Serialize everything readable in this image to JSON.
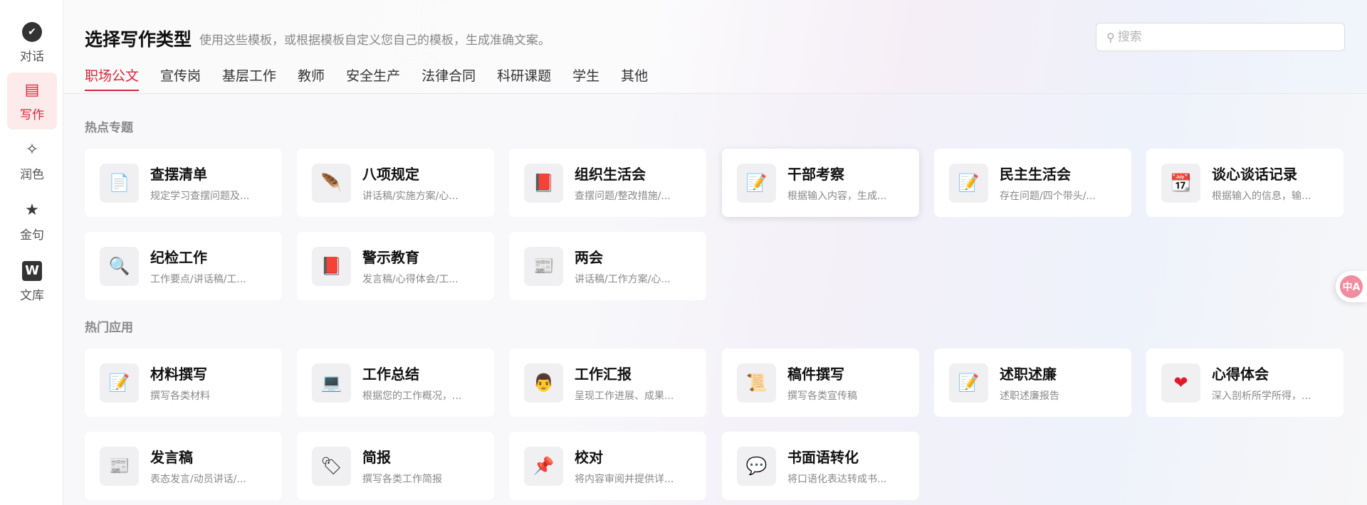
{
  "sidebar": {
    "items": [
      {
        "label": "对话",
        "icon": "chat-bubble-check-icon",
        "glyph": "✔",
        "active": false
      },
      {
        "label": "写作",
        "icon": "document-icon",
        "glyph": "▤",
        "active": true
      },
      {
        "label": "润色",
        "icon": "magic-wand-icon",
        "glyph": "✧",
        "active": false
      },
      {
        "label": "金句",
        "icon": "star-sparkle-icon",
        "glyph": "★",
        "active": false
      },
      {
        "label": "文库",
        "icon": "library-w-icon",
        "glyph": "W",
        "active": false
      }
    ]
  },
  "header": {
    "title": "选择写作类型",
    "subtitle": "使用这些模板，或根据模板自定义您自己的模板，生成准确文案。"
  },
  "search": {
    "placeholder": "搜索",
    "value": ""
  },
  "tabs": [
    {
      "label": "职场公文",
      "active": true
    },
    {
      "label": "宣传岗",
      "active": false
    },
    {
      "label": "基层工作",
      "active": false
    },
    {
      "label": "教师",
      "active": false
    },
    {
      "label": "安全生产",
      "active": false
    },
    {
      "label": "法律合同",
      "active": false
    },
    {
      "label": "科研课题",
      "active": false
    },
    {
      "label": "学生",
      "active": false
    },
    {
      "label": "其他",
      "active": false
    }
  ],
  "sections": [
    {
      "title": "热点专题",
      "cards": [
        {
          "title": "查摆清单",
          "desc": "规定学习查摆问题及...",
          "icon": "page-icon",
          "glyph": "📄"
        },
        {
          "title": "八项规定",
          "desc": "讲话稿/实施方案/心...",
          "icon": "feather-icon",
          "glyph": "🪶"
        },
        {
          "title": "组织生活会",
          "desc": "查摆问题/整改措施/...",
          "icon": "red-book-icon",
          "glyph": "📕"
        },
        {
          "title": "干部考察",
          "desc": "根据输入内容，生成...",
          "icon": "memo-icon",
          "glyph": "📝"
        },
        {
          "title": "民主生活会",
          "desc": "存在问题/四个带头/...",
          "icon": "memo-icon",
          "glyph": "📝"
        },
        {
          "title": "谈心谈话记录",
          "desc": "根据输入的信息，输...",
          "icon": "calendar-icon",
          "glyph": "📆"
        },
        {
          "title": "纪检工作",
          "desc": "工作要点/讲话稿/工...",
          "icon": "magnifier-icon",
          "glyph": "🔍"
        },
        {
          "title": "警示教育",
          "desc": "发言稿/心得体会/工...",
          "icon": "red-book-icon",
          "glyph": "📕"
        },
        {
          "title": "两会",
          "desc": "讲话稿/工作方案/心...",
          "icon": "newspaper-icon",
          "glyph": "📰"
        }
      ]
    },
    {
      "title": "热门应用",
      "cards": [
        {
          "title": "材料撰写",
          "desc": "撰写各类材料",
          "icon": "memo-icon",
          "glyph": "📝"
        },
        {
          "title": "工作总结",
          "desc": "根据您的工作概况，...",
          "icon": "laptop-icon",
          "glyph": "💻"
        },
        {
          "title": "工作汇报",
          "desc": "呈现工作进展、成果...",
          "icon": "office-worker-icon",
          "glyph": "👨"
        },
        {
          "title": "稿件撰写",
          "desc": "撰写各类宣传稿",
          "icon": "scroll-icon",
          "glyph": "📜"
        },
        {
          "title": "述职述廉",
          "desc": "述职述廉报告",
          "icon": "memo-icon",
          "glyph": "📝"
        },
        {
          "title": "心得体会",
          "desc": "深入剖析所学所得，...",
          "icon": "heart-icon",
          "glyph": "❤"
        },
        {
          "title": "发言稿",
          "desc": "表态发言/动员讲话/...",
          "icon": "newspaper-icon",
          "glyph": "📰"
        },
        {
          "title": "简报",
          "desc": "撰写各类工作简报",
          "icon": "tag-icon",
          "glyph": "🏷"
        },
        {
          "title": "校对",
          "desc": "将内容审阅并提供详...",
          "icon": "pushpin-icon",
          "glyph": "📌"
        },
        {
          "title": "书面语转化",
          "desc": "将口语化表达转成书...",
          "icon": "speech-bubble-icon",
          "glyph": "💬"
        }
      ]
    }
  ],
  "floating": {
    "translate_label": "中A",
    "icon": "translate-icon"
  },
  "colors": {
    "accent": "#d6253a",
    "active_nav_bg": "#fdeaea"
  }
}
